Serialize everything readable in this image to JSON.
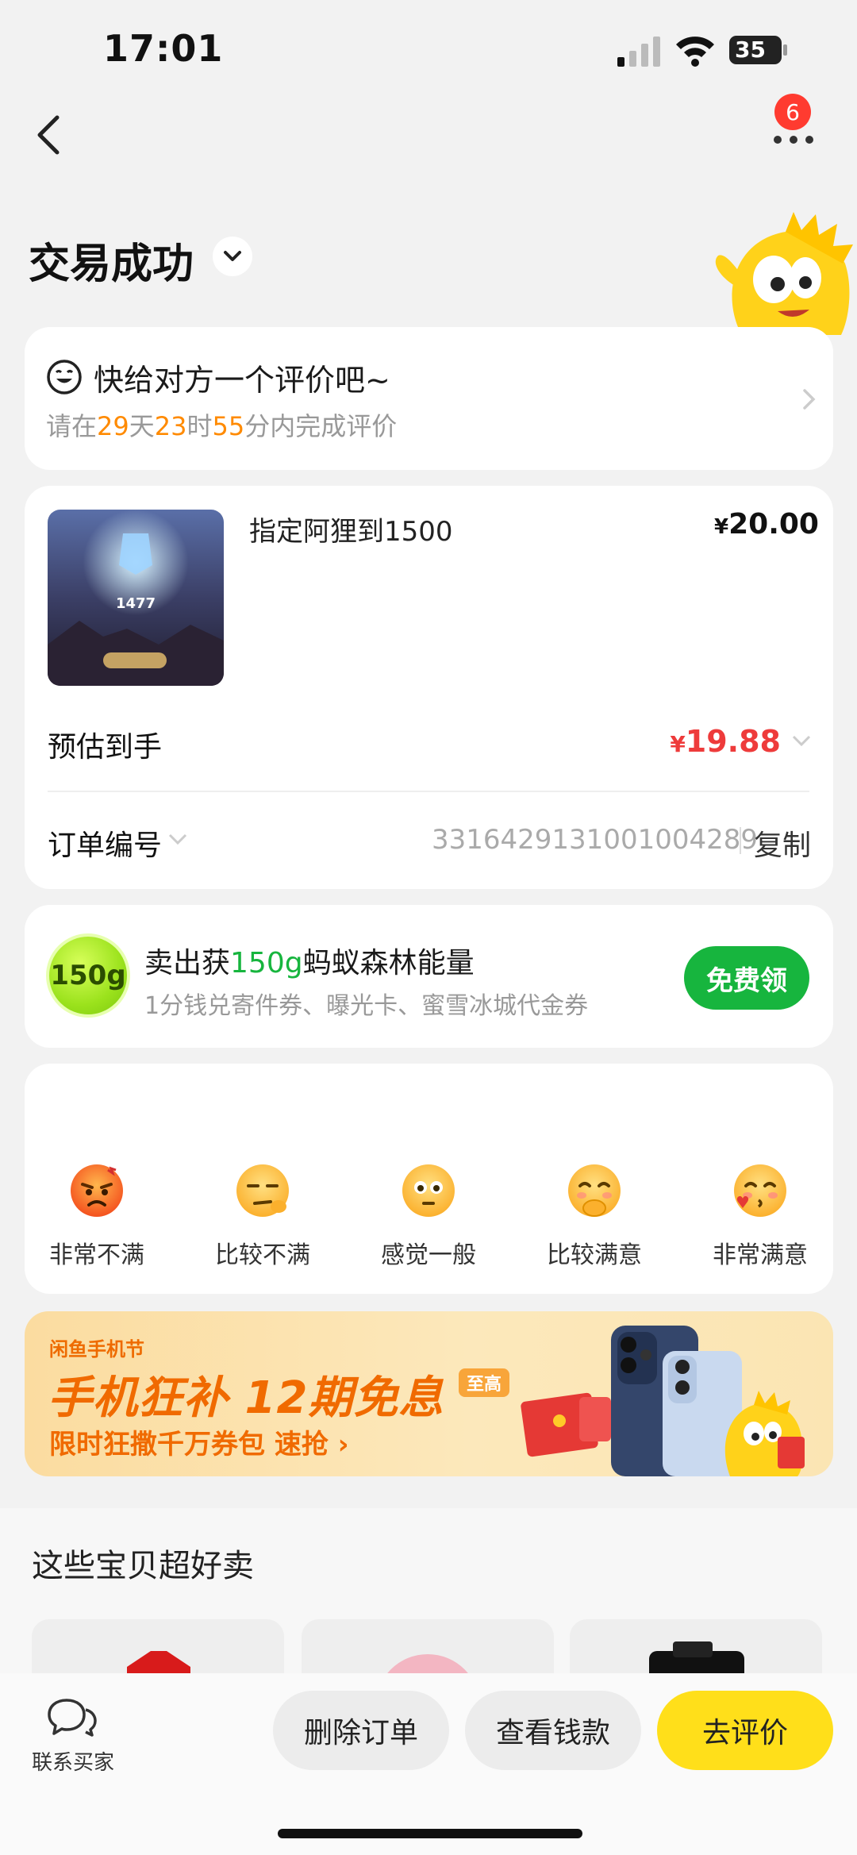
{
  "status_bar": {
    "time": "17:01",
    "battery": "35"
  },
  "nav": {
    "badge_count": "6"
  },
  "page": {
    "title": "交易成功"
  },
  "review_prompt": {
    "title": "快给对方一个评价吧~",
    "sub_prefix": "请在",
    "days": "29",
    "days_unit": "天",
    "hours": "23",
    "hours_unit": "时",
    "minutes": "55",
    "minutes_suffix": "分内完成评价"
  },
  "order": {
    "product_name": "指定阿狸到1500",
    "price_symbol": "¥",
    "price": "20.00",
    "estimate_label": "预估到手",
    "estimate_symbol": "¥",
    "estimate_value": "19.88",
    "order_no_label": "订单编号",
    "order_no": "3316429131001004289",
    "copy_label": "复制",
    "image_score": "1477"
  },
  "energy": {
    "ball_label": "150g",
    "title_prefix": "卖出获",
    "title_highlight": "150g",
    "title_suffix": "蚂蚁森林能量",
    "subtitle": "1分钱兑寄件券、曝光卡、蜜雪冰城代金券",
    "button": "免费领"
  },
  "rating": {
    "options": [
      {
        "label": "非常不满",
        "icon": "angry-face-icon"
      },
      {
        "label": "比较不满",
        "icon": "unamused-face-icon"
      },
      {
        "label": "感觉一般",
        "icon": "neutral-face-icon"
      },
      {
        "label": "比较满意",
        "icon": "happy-face-icon"
      },
      {
        "label": "非常满意",
        "icon": "kissing-face-icon"
      }
    ]
  },
  "banner": {
    "tag": "闲鱼手机节",
    "headline": "手机狂补 12期免息",
    "pill": "至高",
    "subline": "限时狂撒千万券包  速抢 ›"
  },
  "recommend": {
    "title": "这些宝贝超好卖"
  },
  "bottom_bar": {
    "contact": "联系买家",
    "delete": "删除订单",
    "money": "查看钱款",
    "review": "去评价"
  },
  "colors": {
    "accent_yellow": "#ffdf1a",
    "price_red": "#ee3b3b",
    "green": "#17b53e",
    "orange": "#ff8a00"
  }
}
